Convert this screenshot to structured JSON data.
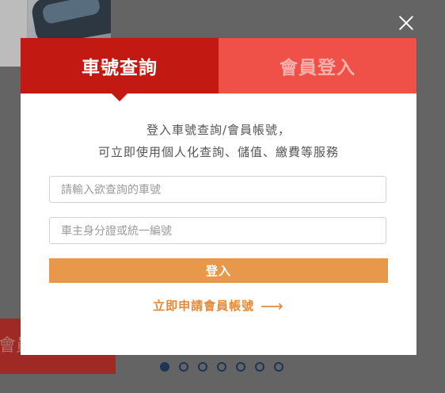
{
  "background": {
    "partial_tab_label": "會員"
  },
  "modal": {
    "tabs": [
      {
        "label": "車號查詢",
        "active": true
      },
      {
        "label": "會員登入",
        "active": false
      }
    ],
    "intro": {
      "line1": "登入車號查詢/會員帳號，",
      "line2": "可立即使用個人化查詢、儲值、繳費等服務"
    },
    "plate_input": {
      "placeholder": "請輸入欲查詢的車號",
      "value": ""
    },
    "id_input": {
      "placeholder": "車主身分證或統一編號",
      "value": ""
    },
    "login_button": "登入",
    "apply_link": {
      "label": "立即申請會員帳號",
      "arrow": "⟶"
    }
  },
  "pagination": {
    "count": 7,
    "active_index": 0
  },
  "colors": {
    "active_tab": "#c21912",
    "inactive_tab": "#ef5148",
    "login_button": "#e8984a",
    "link": "#e08a3b",
    "dot": "#1f3556"
  }
}
